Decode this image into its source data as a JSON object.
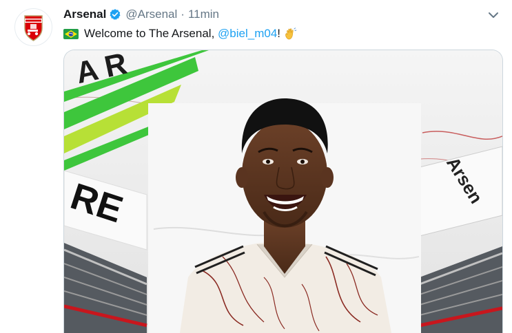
{
  "tweet": {
    "author_name": "Arsenal",
    "handle": "@Arsenal",
    "separator": "·",
    "timestamp": "11min",
    "text_prefix": "Welcome to The Arsenal, ",
    "mention": "@biel_m04",
    "text_suffix": "!",
    "flag_icon": "brazil-flag-icon",
    "emoji_icon": "waving-hand-icon"
  },
  "media": {
    "banner_left_text": "A R",
    "banner_bottom_text": "RE",
    "banner_right_text": "Arsen"
  },
  "colors": {
    "accent": "#1da1f2",
    "secondary_text": "#657786",
    "primary_text": "#14171a",
    "arsenal_red": "#db0007"
  }
}
